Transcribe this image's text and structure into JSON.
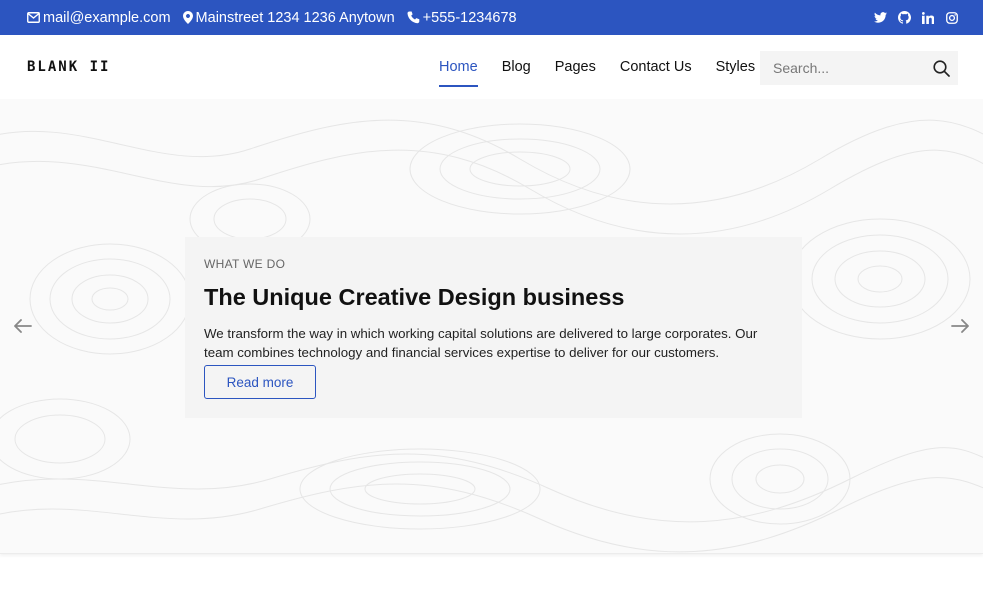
{
  "topbar": {
    "email": "mail@example.com",
    "address": "Mainstreet 1234 1236 Anytown",
    "phone": "+555-1234678",
    "social_icons": [
      "twitter-icon",
      "github-icon",
      "linkedin-icon",
      "instagram-icon"
    ],
    "background_color": "#2c55c0"
  },
  "header": {
    "brand": "BLANK II",
    "nav": [
      {
        "label": "Home",
        "active": true
      },
      {
        "label": "Blog",
        "active": false
      },
      {
        "label": "Pages",
        "active": false
      },
      {
        "label": "Contact Us",
        "active": false
      },
      {
        "label": "Styles",
        "active": false
      }
    ],
    "search": {
      "placeholder": "Search...",
      "value": ""
    },
    "accent_color": "#2c55c0"
  },
  "hero": {
    "eyebrow": "WHAT WE DO",
    "title": "The Unique Creative Design business",
    "body": "We transform the way in which working capital solutions are delivered to large corporates. Our team combines technology and financial services expertise to deliver for our customers.",
    "cta_label": "Read more",
    "prev_icon": "arrow-left-icon",
    "next_icon": "arrow-right-icon"
  }
}
